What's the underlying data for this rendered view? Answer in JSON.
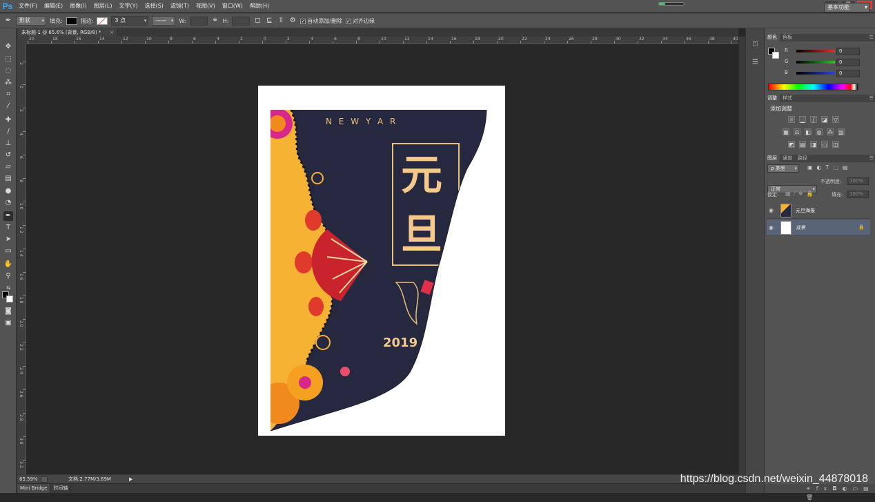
{
  "app": {
    "logo": "Ps"
  },
  "menu": [
    "文件(F)",
    "编辑(E)",
    "图像(I)",
    "图层(L)",
    "文字(Y)",
    "选择(S)",
    "滤镜(T)",
    "视图(V)",
    "窗口(W)",
    "帮助(H)"
  ],
  "window_controls": {
    "minimize": "—",
    "restore": "❐",
    "close": "✕"
  },
  "progress": {
    "fraction": 0.25,
    "color": "#4cc070"
  },
  "options_bar": {
    "tool_mode": "形状",
    "fill_label": "填充:",
    "stroke_label": "描边:",
    "stroke_width": "3 点",
    "w_label": "W:",
    "h_label": "H:",
    "auto_add_delete": "自动添加/删除",
    "align_edges": "对齐边缘",
    "workspace": "基本功能"
  },
  "document": {
    "tab_title": "未标题-1 @ 65.6% (背景, RGB/8) *",
    "tab_close": "×",
    "zoom": "65.59%",
    "doc_info": "文档:2.77M/3.69M"
  },
  "rulers": {
    "top": [
      "20",
      "18",
      "16",
      "14",
      "12",
      "10",
      "8",
      "6",
      "4",
      "2",
      "0",
      "2",
      "4",
      "6",
      "8",
      "10",
      "12",
      "14",
      "16",
      "18",
      "20",
      "22",
      "24",
      "26",
      "28",
      "30",
      "32",
      "34",
      "36",
      "38",
      "40"
    ],
    "left": [
      "2",
      "0",
      "2",
      "4",
      "6",
      "8",
      "1 0",
      "1 2",
      "1 4",
      "1 6",
      "1 8",
      "2 0",
      "2 2",
      "2 4",
      "2 6",
      "2 8",
      "3 0",
      "3 2"
    ]
  },
  "poster": {
    "title_small": "N E W Y A R",
    "title_big": "元旦",
    "year": "2019",
    "colors": {
      "navy": "#262840",
      "gold": "#f5b233",
      "paper": "#ffffff",
      "accent": "#e8c07a"
    }
  },
  "panels": {
    "color_tabs": [
      "颜色",
      "色板"
    ],
    "rgb": [
      {
        "label": "R",
        "value": "0",
        "color": "#e03030"
      },
      {
        "label": "G",
        "value": "0",
        "color": "#30c030"
      },
      {
        "label": "B",
        "value": "0",
        "color": "#3040e0"
      }
    ],
    "adjust_tabs": [
      "调整",
      "样式"
    ],
    "adjust_title": "添加调整",
    "layers_tabs": [
      "图层",
      "通道",
      "路径"
    ],
    "layer_kind": "ρ 类型",
    "blend_mode": "正常",
    "opacity_label": "不透明度:",
    "opacity_value": "100%",
    "lock_label": "锁定:",
    "fill_label": "填充:",
    "fill_value": "100%",
    "layers": [
      {
        "name": "元旦海报",
        "selected": false
      },
      {
        "name": "背景",
        "selected": true
      }
    ]
  },
  "bottom_tabs": [
    "Mini Bridge",
    "时间轴"
  ],
  "watermark": "https://blog.csdn.net/weixin_44878018"
}
